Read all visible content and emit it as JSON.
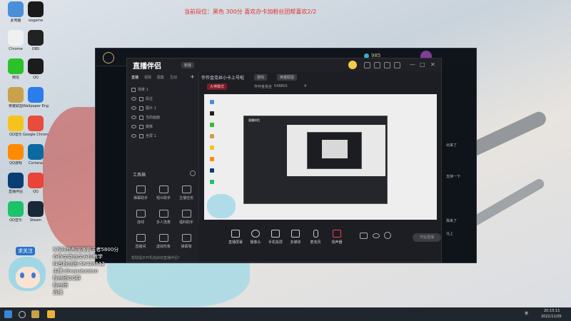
{
  "banner": "当前段位：黑色 300分  喜欢办卡加粉丝团帮喜欢2/2",
  "desktop_icons": [
    {
      "label": "此电脑",
      "color": "#4a90d9"
    },
    {
      "label": "oogame",
      "color": "#1a1a1a"
    },
    {
      "label": "Chrome",
      "color": "#f0f0f0"
    },
    {
      "label": "OBS",
      "color": "#222"
    },
    {
      "label": "微信",
      "color": "#2ac12a"
    },
    {
      "label": "QQ",
      "color": "#1c1c1c"
    },
    {
      "label": "英雄联盟",
      "color": "#c8a14a"
    },
    {
      "label": "Wallpaper Engine",
      "color": "#2b7de9"
    },
    {
      "label": "QQ音乐",
      "color": "#f6c31c"
    },
    {
      "label": "Google Chrome",
      "color": "#e84c3d"
    },
    {
      "label": "QQ游戏",
      "color": "#ff8a00"
    },
    {
      "label": "Cortana",
      "color": "#0b6aa2"
    },
    {
      "label": "直播伴侣",
      "color": "#0a3d73"
    },
    {
      "label": "QQ",
      "color": "#e8443a"
    },
    {
      "label": "QQ音乐",
      "color": "#1cc36b"
    },
    {
      "label": "Steam",
      "color": "#1b2838"
    }
  ],
  "app": {
    "logo": "直播伴侣",
    "version": "新版",
    "tabs": [
      {
        "label": "直播",
        "active": true
      },
      {
        "label": "视频",
        "active": false
      },
      {
        "label": "图集",
        "active": false
      },
      {
        "label": "互动",
        "active": false
      }
    ],
    "scene_rows": [
      "场景 1",
      "段位",
      "图片 1",
      "当前画面",
      "摄像",
      "全屏 1"
    ],
    "tools_title": "工具箱",
    "tools": [
      "弹幕助手",
      "观众助手",
      "主播任务",
      "连线",
      "多人连麦",
      "福利助手",
      "直播间",
      "虚拟形象",
      "弹幕墙"
    ],
    "hint": "帮助提示开机自启动直播伴侣?",
    "stream_title": "作作金克丝小卡上号啦",
    "tag_1": "游戏",
    "category": "英雄联盟",
    "mode": "大神模式",
    "viewers_label": "作作金克丝",
    "viewers_count": "549801",
    "followers": "4",
    "controls": [
      "直播屏幕",
      "摄像头",
      "手机投屏",
      "多媒体",
      "麦克风",
      "扬声器"
    ],
    "start_label": "开始直播"
  },
  "lol": {
    "currency": "985",
    "chat_lines": [
      "出来了",
      "支持一下",
      "我来了",
      "马上"
    ]
  },
  "overlay": {
    "follow": "求关注",
    "lines": [
      "5万抖音热搜播霸王者5800分",
      "作作金克丝金方位教学",
      "抖音粉丝团:58428512",
      "主播:douyuzuozuo",
      "粉丝团QQ群",
      "粉丝团",
      "直播"
    ]
  },
  "taskbar": {
    "lang": "英",
    "time": "20:15:11",
    "date": "2022/11/05"
  }
}
